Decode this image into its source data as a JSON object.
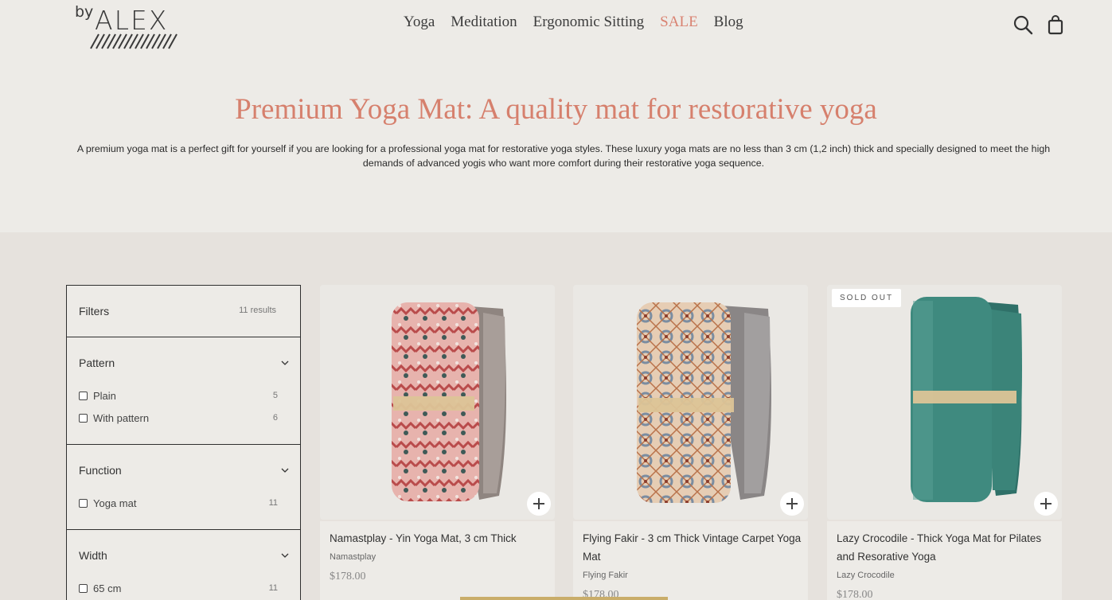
{
  "brand": {
    "by": "by",
    "name": "ALEX"
  },
  "nav": [
    "Yoga",
    "Meditation",
    "Ergonomic Sitting",
    "SALE",
    "Blog"
  ],
  "colors": {
    "accent": "#d6806d",
    "sale": "#d98271",
    "background": "#edebe7",
    "section": "#e6e2dd"
  },
  "icons": {
    "search": "search-icon",
    "cart": "shopping-bag-icon",
    "chevron": "chevron-down-icon",
    "add": "plus-icon"
  },
  "page": {
    "title": "Premium Yoga Mat: A quality mat for restorative yoga",
    "description": "A premium yoga mat is a perfect gift for yourself if you are looking for a professional yoga mat for restorative yoga styles. These luxury yoga mats are no less than 3 cm (1,2 inch) thick and specially designed to meet the high demands of advanced yogis who want more comfort during their restorative yoga sequence."
  },
  "filters": {
    "title": "Filters",
    "count": "11 results",
    "groups": [
      {
        "title": "Pattern",
        "options": [
          {
            "label": "Plain",
            "count": "5"
          },
          {
            "label": "With pattern",
            "count": "6"
          }
        ]
      },
      {
        "title": "Function",
        "options": [
          {
            "label": "Yoga mat",
            "count": "11"
          }
        ]
      },
      {
        "title": "Width",
        "options": [
          {
            "label": "65 cm",
            "count": "11"
          }
        ]
      }
    ]
  },
  "products": [
    {
      "name": "Namastplay - Yin Yoga Mat, 3 cm Thick",
      "vendor": "Namastplay",
      "price": "$178.00",
      "badge": ""
    },
    {
      "name": "Flying Fakir - 3 cm Thick Vintage Carpet Yoga Mat",
      "vendor": "Flying Fakir",
      "price": "$178.00",
      "badge": ""
    },
    {
      "name": "Lazy Crocodile - Thick Yoga Mat for Pilates and Resorative Yoga",
      "vendor": "Lazy Crocodile",
      "price": "$178.00",
      "badge": "SOLD OUT"
    }
  ]
}
